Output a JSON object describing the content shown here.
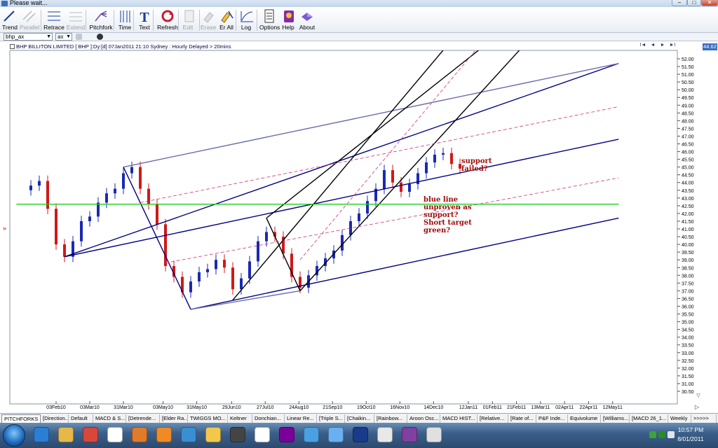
{
  "window": {
    "title": "Please wait..."
  },
  "toolbar": [
    {
      "label": "Trend",
      "icon": "trend-icon",
      "enabled": true
    },
    {
      "label": "Parallel",
      "icon": "parallel-icon",
      "enabled": false
    },
    {
      "label": "Retrace",
      "icon": "retrace-icon",
      "enabled": true
    },
    {
      "label": "Extend",
      "icon": "extend-icon",
      "enabled": false
    },
    {
      "label": "Pitchfork",
      "icon": "pitchfork-icon",
      "enabled": true
    },
    {
      "label": "Time",
      "icon": "time-icon",
      "enabled": true
    },
    {
      "label": "Text",
      "icon": "text-icon",
      "enabled": true
    },
    {
      "label": "Refresh",
      "icon": "refresh-icon",
      "enabled": true
    },
    {
      "label": "Edit",
      "icon": "edit-icon",
      "enabled": false
    },
    {
      "label": "Erase",
      "icon": "erase-icon",
      "enabled": false
    },
    {
      "label": "Er All",
      "icon": "erase-all-icon",
      "enabled": true
    },
    {
      "label": "Log",
      "icon": "log-icon",
      "enabled": true
    },
    {
      "label": "Options",
      "icon": "options-icon",
      "enabled": true
    },
    {
      "label": "Help",
      "icon": "help-icon",
      "enabled": true
    },
    {
      "label": "About",
      "icon": "about-icon",
      "enabled": true
    }
  ],
  "row2": {
    "symbol": "bhp_ax",
    "exchange": "ax"
  },
  "chart": {
    "header": "BHP BILLITON LIMITED [ BHP ]:Dy:[d]  07Jan2011 21:10 Sydney : Hourly Delayed > 20mins",
    "last_price": "44.62",
    "nav": [
      "I◄",
      "◄",
      "►",
      "►I"
    ],
    "price_marker": "»",
    "annotations": [
      "support\nfailed?",
      "blue line\nunproven as\nsupport?\nShort target\ngreen?"
    ]
  },
  "chart_data": {
    "type": "candlestick",
    "x_dates": [
      "03Feb10",
      "03Mar10",
      "31Mar10",
      "03May10",
      "31May10",
      "29Jun10",
      "27Jul10",
      "24Aug10",
      "21Sep10",
      "19Oct10",
      "16Nov10",
      "14Dec10",
      "12Jan11",
      "01Feb11",
      "21Feb11",
      "13Mar11",
      "02Apr11",
      "22Apr11",
      "12May11"
    ],
    "y_ticks": [
      "52.00",
      "51.50",
      "51.00",
      "50.50",
      "50.00",
      "49.50",
      "49.00",
      "48.50",
      "48.00",
      "47.50",
      "47.00",
      "46.50",
      "46.00",
      "45.50",
      "45.00",
      "44.50",
      "44.00",
      "43.50",
      "43.00",
      "42.50",
      "42.00",
      "41.50",
      "41.00",
      "40.50",
      "40.00",
      "39.50",
      "39.00",
      "38.50",
      "38.00",
      "37.50",
      "37.00",
      "36.50",
      "36.00",
      "35.50",
      "35.00",
      "34.50",
      "34.00",
      "33.50",
      "33.00",
      "32.50",
      "32.00",
      "31.50",
      "31.00",
      "30.50"
    ],
    "ylim": [
      30.5,
      52.0
    ],
    "grid": false,
    "prices": [
      [
        "2010-01-13",
        43.8
      ],
      [
        "2010-01-20",
        44.1
      ],
      [
        "2010-01-27",
        42.3
      ],
      [
        "2010-02-03",
        40.0
      ],
      [
        "2010-02-10",
        39.2
      ],
      [
        "2010-02-17",
        40.2
      ],
      [
        "2010-02-24",
        41.5
      ],
      [
        "2010-03-03",
        41.8
      ],
      [
        "2010-03-10",
        42.7
      ],
      [
        "2010-03-17",
        43.3
      ],
      [
        "2010-03-24",
        43.6
      ],
      [
        "2010-03-31",
        44.6
      ],
      [
        "2010-04-07",
        45.0
      ],
      [
        "2010-04-14",
        43.6
      ],
      [
        "2010-04-21",
        42.6
      ],
      [
        "2010-04-28",
        41.3
      ],
      [
        "2010-05-05",
        38.6
      ],
      [
        "2010-05-12",
        37.9
      ],
      [
        "2010-05-19",
        36.9
      ],
      [
        "2010-05-26",
        37.6
      ],
      [
        "2010-06-02",
        38.2
      ],
      [
        "2010-06-09",
        38.4
      ],
      [
        "2010-06-16",
        39.0
      ],
      [
        "2010-06-23",
        38.5
      ],
      [
        "2010-06-30",
        37.1
      ],
      [
        "2010-07-07",
        37.8
      ],
      [
        "2010-07-14",
        38.9
      ],
      [
        "2010-07-21",
        40.2
      ],
      [
        "2010-07-28",
        40.8
      ],
      [
        "2010-08-04",
        40.5
      ],
      [
        "2010-08-11",
        39.4
      ],
      [
        "2010-08-18",
        37.9
      ],
      [
        "2010-08-25",
        37.2
      ],
      [
        "2010-09-01",
        38.0
      ],
      [
        "2010-09-08",
        38.6
      ],
      [
        "2010-09-15",
        39.1
      ],
      [
        "2010-09-22",
        39.6
      ],
      [
        "2010-09-29",
        40.6
      ],
      [
        "2010-10-06",
        41.5
      ],
      [
        "2010-10-13",
        42.0
      ],
      [
        "2010-10-20",
        42.8
      ],
      [
        "2010-10-27",
        43.6
      ],
      [
        "2010-11-03",
        44.8
      ],
      [
        "2010-11-10",
        44.0
      ],
      [
        "2010-11-17",
        43.4
      ],
      [
        "2010-11-24",
        43.9
      ],
      [
        "2010-12-01",
        44.6
      ],
      [
        "2010-12-08",
        45.3
      ],
      [
        "2010-12-15",
        45.8
      ],
      [
        "2010-12-22",
        45.9
      ],
      [
        "2010-12-29",
        45.2
      ],
      [
        "2011-01-05",
        44.9
      ]
    ],
    "lines": [
      {
        "color": "#000080",
        "pts": [
          [
            "2010-02-10",
            39.2
          ],
          [
            "2011-05-17",
            51.7
          ]
        ]
      },
      {
        "color": "#000080",
        "pts": [
          [
            "2010-02-10",
            39.2
          ],
          [
            "2011-05-17",
            46.8
          ]
        ]
      },
      {
        "color": "#000080",
        "pts": [
          [
            "2010-05-26",
            35.8
          ],
          [
            "2011-05-17",
            41.7
          ]
        ]
      },
      {
        "color": "#6a6ab0",
        "pts": [
          [
            "2010-03-31",
            45.0
          ],
          [
            "2011-05-17",
            51.7
          ]
        ]
      },
      {
        "color": "#6a6ab0",
        "pts": [
          [
            "2010-05-26",
            35.8
          ],
          [
            "2010-08-25",
            37.0
          ]
        ]
      },
      {
        "color": "#000080",
        "pts": [
          [
            "2010-03-31",
            45.0
          ],
          [
            "2010-05-26",
            35.8
          ]
        ]
      },
      {
        "color": "#000000",
        "pts": [
          [
            "2010-06-30",
            36.4
          ],
          [
            "2010-12-29",
            53.2
          ]
        ]
      },
      {
        "color": "#000000",
        "pts": [
          [
            "2010-07-28",
            41.7
          ],
          [
            "2011-01-31",
            53.2
          ]
        ]
      },
      {
        "color": "#000000",
        "pts": [
          [
            "2010-08-25",
            37.0
          ],
          [
            "2011-03-03",
            53.2
          ]
        ]
      },
      {
        "color": "#000000",
        "pts": [
          [
            "2010-07-28",
            41.7
          ],
          [
            "2010-08-25",
            37.0
          ]
        ]
      },
      {
        "color": "#cc3377",
        "dash": true,
        "pts": [
          [
            "2010-04-14",
            42.7
          ],
          [
            "2011-05-17",
            48.9
          ]
        ]
      },
      {
        "color": "#cc3377",
        "dash": true,
        "pts": [
          [
            "2010-05-05",
            38.8
          ],
          [
            "2011-05-17",
            44.3
          ]
        ]
      },
      {
        "color": "#cc3377",
        "dash": true,
        "pts": [
          [
            "2010-08-25",
            39.0
          ],
          [
            "2011-01-25",
            53.2
          ]
        ]
      },
      {
        "color": "#22cc22",
        "pts": [
          [
            "2010-01-01",
            42.6
          ],
          [
            "2011-05-17",
            42.6
          ]
        ]
      }
    ]
  },
  "tabs": [
    "PITCHFORKS",
    "[Direction...",
    "Default",
    "MACD & S...",
    "[Detrende...",
    "[Elder Ra...",
    "TWIGGS MO...",
    "Keltner",
    "Donchian...",
    "Linear Re...",
    "[Triple S...",
    "[Chaikin...",
    "[Rainbow...",
    "Aroon Osc...",
    "MACD HIST...",
    "[Relative...",
    "[Rate of...",
    "P&F Inde...",
    "Equivolume",
    "[Williams...",
    "[MACD 26_1...",
    "Weekly",
    ">>>>>"
  ],
  "taskbar": {
    "time": "10:57 PM",
    "date": "8/01/2011",
    "apps": [
      {
        "name": "ie-icon",
        "color": "#2a7fd4"
      },
      {
        "name": "folder-icon",
        "color": "#e6b84a"
      },
      {
        "name": "chrome-icon",
        "color": "#d9473a"
      },
      {
        "name": "gmail-icon",
        "color": "#ffffff"
      },
      {
        "name": "media-player-icon",
        "color": "#e07b2a"
      },
      {
        "name": "rss-icon",
        "color": "#f08a24"
      },
      {
        "name": "calendar-icon",
        "color": "#3a8fd0"
      },
      {
        "name": "h-icon",
        "color": "#f2c84b"
      },
      {
        "name": "camera-icon",
        "color": "#444444"
      },
      {
        "name": "ebay-icon",
        "color": "#ffffff"
      },
      {
        "name": "yahoo-icon",
        "color": "#7b0099"
      },
      {
        "name": "mail-icon",
        "color": "#4aa0e0"
      },
      {
        "name": "itunes-icon",
        "color": "#6ab0f0"
      },
      {
        "name": "chart-app-icon",
        "color": "#1a3a8a"
      },
      {
        "name": "fc-icon",
        "color": "#e8e8e8"
      },
      {
        "name": "winzip-icon",
        "color": "#8040a0"
      },
      {
        "name": "calculator-icon",
        "color": "#e0e0e0"
      }
    ]
  }
}
